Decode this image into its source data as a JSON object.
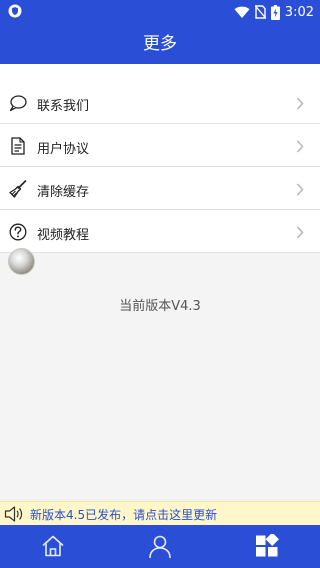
{
  "status_bar": {
    "time": "3:02"
  },
  "header": {
    "title": "更多"
  },
  "menu": {
    "items": [
      {
        "label": "联系我们",
        "icon": "chat-bubble-icon"
      },
      {
        "label": "用户协议",
        "icon": "document-icon"
      },
      {
        "label": "清除缓存",
        "icon": "broom-icon"
      },
      {
        "label": "视频教程",
        "icon": "help-circle-icon"
      }
    ]
  },
  "version_text": "当前版本V4.3",
  "update_banner": {
    "text": "新版本4.5已发布，请点击这里更新"
  },
  "tabbar": {
    "tabs": [
      {
        "icon": "home-icon"
      },
      {
        "icon": "user-icon"
      },
      {
        "icon": "apps-icon"
      }
    ],
    "active_index": 2
  },
  "colors": {
    "brand": "#2a4fd6",
    "banner_bg": "#fff6c9"
  }
}
